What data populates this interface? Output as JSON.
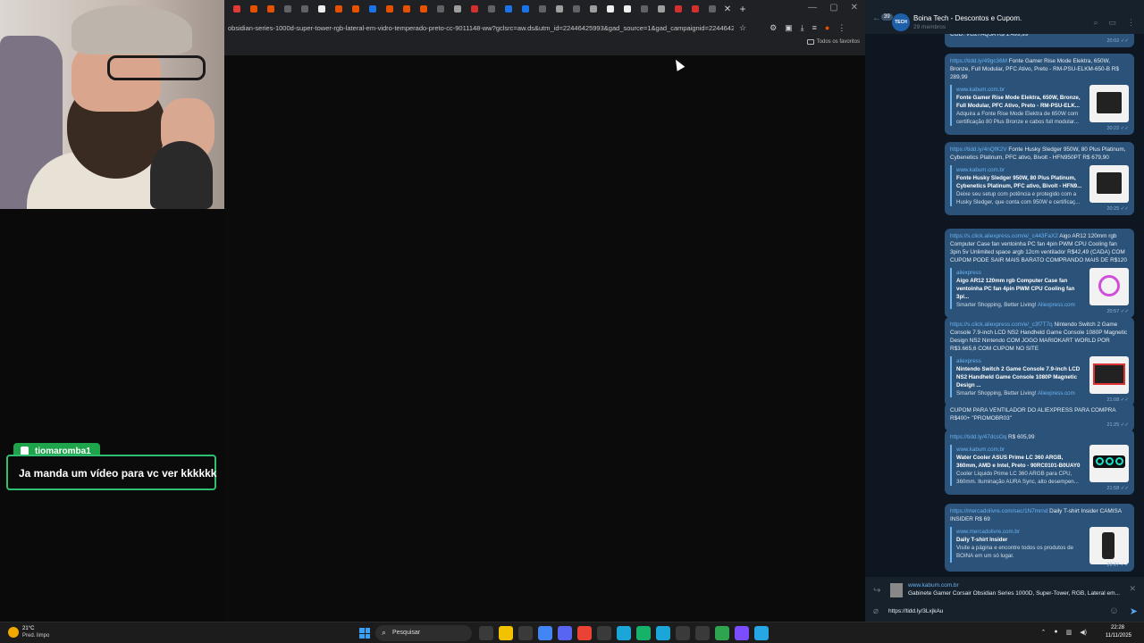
{
  "browser": {
    "url": "obsidian-series-1000d-super-tower-rgb-lateral-em-vidro-temperado-preto-cc-9011148-ww?gclsrc=aw.ds&utm_id=22446425993&gad_source=1&gad_campaignid=22446425993&g",
    "bookmarks_label": "Todos os favoritos",
    "tab_favicon_colors": [
      "#e53935",
      "#e65100",
      "#e65100",
      "#5f6368",
      "#5f6368",
      "#eeeeee",
      "#e65100",
      "#e65100",
      "#1a73e8",
      "#e65100",
      "#e65100",
      "#e65100",
      "#5f6368",
      "#9e9e9e",
      "#d32f2f",
      "#5f6368",
      "#1a73e8",
      "#1a73e8",
      "#5f6368",
      "#9e9e9e",
      "#5f6368",
      "#9e9e9e",
      "#eeeeee",
      "#eeeeee",
      "#5f6368",
      "#9e9e9e",
      "#d32f2f",
      "#d32f2f",
      "#5f6368"
    ]
  },
  "chat": {
    "username": "tiomaromba1",
    "message": "Ja manda um vídeo para vc ver kkkkkk"
  },
  "telegram": {
    "unread_count": "39",
    "avatar_text": "TECH",
    "channel_title": "Boina Tech - Descontos e Cupom.",
    "members": "29 membros",
    "messages": [
      {
        "link": "",
        "text": "COD: VG27AQ5A R$ 1.499,99",
        "time": "20:02",
        "preview": null
      },
      {
        "link": "https://tidd.ly/49gc36M",
        "text": " Fonte Gamer Rise Mode Elektra, 650W, Bronze, Full Modular, PFC Ativo, Preto - RM-PSU-ELKM-650-B R$ 289,99",
        "time": "20:22",
        "preview": {
          "site": "www.kabum.com.br",
          "title": "Fonte Gamer Rise Mode Elektra, 650W, Bronze, Full Modular, PFC Ativo, Preto - RM-PSU-ELK...",
          "desc": "Adquira a Fonte Rise Mode Elektra de 650W com certificação 80 Plus Bronze e cabos full modular...",
          "thumb": "psu"
        }
      },
      {
        "link": "https://tidd.ly/4nQfK2V",
        "text": " Fonte Husky Sledger 950W, 80 Plus Platinum, Cybenetics Platinum, PFC ativo, Bivolt - HFN950PT R$ 679,90",
        "time": "20:25",
        "preview": {
          "site": "www.kabum.com.br",
          "title": "Fonte Husky Sledger 950W, 80 Plus Platinum, Cybenetics Platinum, PFC ativo, Bivolt - HFN9...",
          "desc": "Deixe seu setup com potência e protegido com a Husky Sledger, que conta com 950W e certificaç...",
          "thumb": "psu"
        }
      },
      {
        "link": "https://s.click.aliexpress.com/e/_c443FaX2",
        "text": " Aigo AR12 120mm rgb Computer Case fan ventoinha PC fan 4pin PWM CPU Cooling fan 3pin 5v Unlimited space argb 12cm ventilador R$42,49 (CADA) COM CUPOM PODE SAIR MAIS BARATO COMPRANDO MAIS DE R$120",
        "time": "20:57",
        "preview": {
          "site": "aliexpress",
          "title": "Aigo AR12 120mm rgb Computer Case fan ventoinha PC fan 4pin PWM CPU Cooling fan 3pi...",
          "desc": "Smarter Shopping, Better Living! ",
          "desc_link": "Aliexpress.com",
          "thumb": "fan"
        }
      },
      {
        "link": "https://s.click.aliexpress.com/e/_c3f7T7q",
        "text": " Nintendo Switch 2 Game Console 7.9-inch LCD NS2 Handheld Game Console 1080P Magnetic Design NS2 Nintendo COM JOGO MARIOKART WORLD POR R$3.665,6 COM CUPOM NO SITE",
        "time": "21:08",
        "preview": {
          "site": "aliexpress",
          "title": "Nintendo Switch 2 Game Console 7.9-inch LCD NS2 Handheld Game Console 1080P Magnetic Design ...",
          "desc": "Smarter Shopping, Better Living! ",
          "desc_link": "Aliexpress.com",
          "thumb": "console"
        }
      },
      {
        "link": "",
        "text": "CUPOM PARA VENTILADOR DO ALIEXPRESS PARA COMPRA R$400+ \"PROMOBR03\"",
        "time": "21:25",
        "preview": null
      },
      {
        "link": "https://tidd.ly/47dcsOq",
        "text": " R$ 605,99",
        "time": "21:58",
        "preview": {
          "site": "www.kabum.com.br",
          "title": "Water Cooler ASUS Prime LC 360 ARGB, 360mm, AMD e Intel, Preto - 90RC0101-B0UAY0",
          "desc": "Cooler Líquido Prime LC 360 ARGB para CPU, 360mm. Iluminação AURA Sync, alto desempen...",
          "thumb": "cooler"
        }
      },
      {
        "link": "https://mercadolivre.com/sec/1N7mrnd",
        "text": " Daily T-shirt Insider CAMISA INSIDER R$ 69",
        "time": "22:27",
        "preview": {
          "site": "www.mercadolivre.com.br",
          "title": "Daily T-shirt Insider",
          "desc": "Visite a página e encontre todos os produtos de BOINA em um só lugar.",
          "thumb": "shirt"
        }
      }
    ],
    "reply": {
      "site": "www.kabum.com.br",
      "text": "Gabinete Gamer Corsair Obsidian Series 1000D, Super-Tower, RGB, Lateral em..."
    },
    "input_value": "https://tidd.ly/3LxjkAu"
  },
  "taskbar": {
    "temperature": "21°C",
    "weather": "Pred. limpo",
    "search_placeholder": "Pesquisar",
    "time": "22:28",
    "date": "11/11/2025",
    "app_colors": [
      "#3a3a3a",
      "#f2c200",
      "#3a3a3a",
      "#4285f4",
      "#5865f2",
      "#ea4335",
      "#3a3a3a",
      "#1aa6d8",
      "#17b26a",
      "#1aa6d8",
      "#3a3a3a",
      "#3a3a3a",
      "#2ea44f",
      "#7c4dff",
      "#27a6e5"
    ]
  }
}
